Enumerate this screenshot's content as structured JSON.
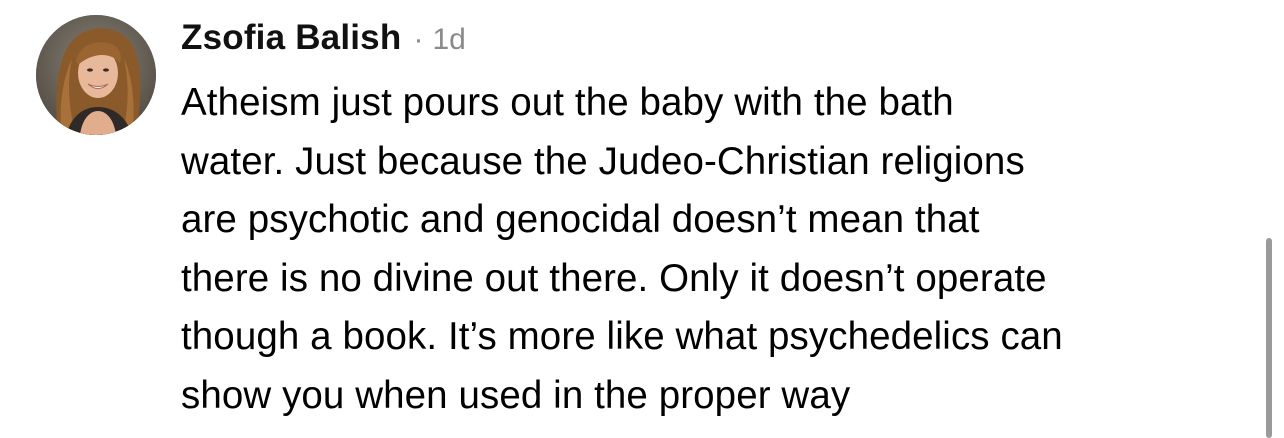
{
  "comment": {
    "author": "Zsofia Balish",
    "separator": "·",
    "timestamp": "1d",
    "body_lines": [
      "Atheism just pours out the baby with the bath",
      "water. Just because the Judeo-Christian religions",
      "are psychotic and genocidal doesn’t mean that",
      "there is no divine out there. Only it doesn’t operate",
      "though a book. It’s more like what psychedelics can",
      "show you when used in the proper way"
    ]
  },
  "colors": {
    "text": "#000000",
    "meta": "#8a8a8a",
    "scrollbar": "#9a9a9a"
  }
}
